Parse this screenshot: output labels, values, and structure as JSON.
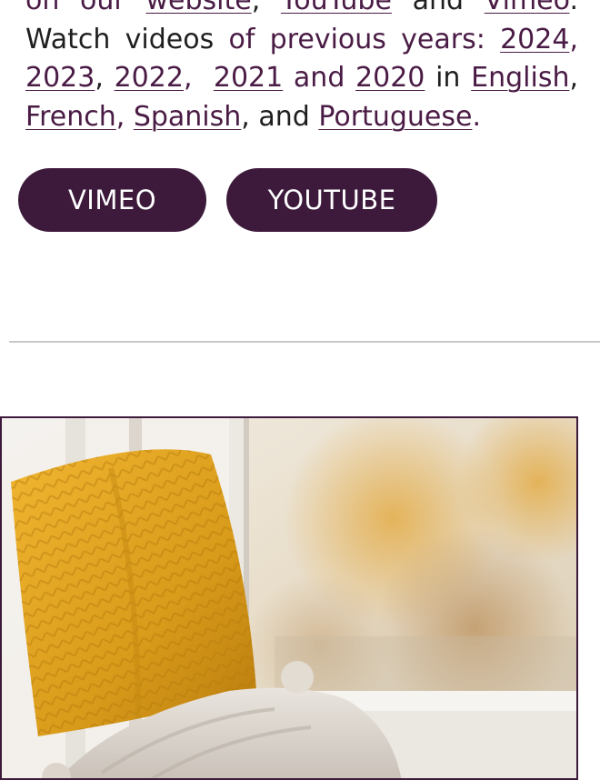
{
  "intro": {
    "line1_prefix": "on our ",
    "link_website": "website",
    "sep1": ", ",
    "link_youtube": "YouTube",
    "and1": " and ",
    "link_vimeo": "Vimeo",
    "period1": ".",
    "watch_prefix": "Watch videos ",
    "watch_mid": "of previous years: ",
    "year_2024": "2024",
    "year_2023": "2023",
    "year_2022": "2022",
    "year_2021": "2021",
    "and2": " and ",
    "year_2020": "2020",
    "in_text": "  in ",
    "lang_english": "English",
    "lang_french": "French",
    "lang_spanish": "Spanish",
    "and3": ", and ",
    "lang_portuguese": "Portuguese",
    "period2": "."
  },
  "buttons": {
    "vimeo_label": "VIMEO",
    "youtube_label": "YOUTUBE"
  },
  "photo": {
    "subject": "yellow knit pillow on window seat with blanket"
  },
  "colors": {
    "brand": "#3d1a3b",
    "link": "#4a1c45",
    "divider": "#c9c9c9"
  }
}
